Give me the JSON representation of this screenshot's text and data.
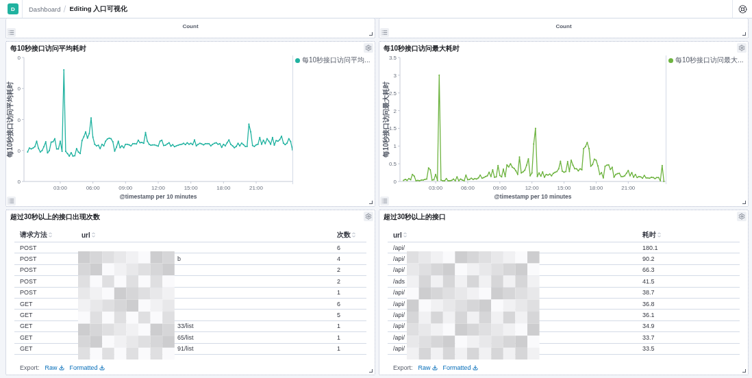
{
  "header": {
    "avatar": "D",
    "breadcrumbs": [
      {
        "label": "Dashboard",
        "current": false
      },
      {
        "label": "Editing 入口可视化",
        "current": true
      }
    ]
  },
  "top_panels": [
    {
      "axis_title": "Count"
    },
    {
      "axis_title": "Count"
    }
  ],
  "avg_panel": {
    "title": "每10秒接口访问平均耗时",
    "y_axis_title": "每10秒接口访问平均耗时",
    "y_tick_labels": [
      "0",
      "0",
      "0",
      "0",
      "0"
    ],
    "x_tick_labels": [
      "03:00",
      "06:00",
      "09:00",
      "12:00",
      "15:00",
      "18:00",
      "21:00"
    ],
    "x_axis_title": "@timestamp per 10 minutes",
    "legend": "每10秒接口访问平均..."
  },
  "max_panel": {
    "title": "每10秒接口访问最大耗时",
    "x_tick_labels": [
      "03:00",
      "06:00",
      "09:00",
      "12:00",
      "15:00",
      "18:00",
      "21:00"
    ],
    "chart_data": {
      "type": "line",
      "xlabel": "@timestamp per 10 minutes",
      "ylabel": "每10秒接口访问最大耗时",
      "ylim": [
        0,
        3.5
      ],
      "yticks": [
        0,
        {
          "value": 0.5,
          "label": "0.5"
        },
        {
          "value": 1,
          "label": "1"
        },
        {
          "value": 1.5,
          "label": "1.5"
        },
        {
          "value": 2,
          "label": "2"
        },
        {
          "value": 2.5,
          "label": "2.5"
        },
        {
          "value": 3,
          "label": "3"
        },
        {
          "value": 3.5,
          "label": "3.5"
        }
      ],
      "series": [
        {
          "name": "每10秒接口访问最大...",
          "color": "#6db33f",
          "values": [
            0.03,
            0.06,
            0.03,
            0.08,
            0.05,
            0.2,
            0.15,
            0.02,
            0.03,
            0.02,
            0.04,
            0.04,
            0.06,
            0.07,
            0.38,
            0.33,
            0.04,
            0.05,
            0.2,
            0.03,
            3.0,
            0.04,
            0.02,
            0.02,
            0.08,
            0.02,
            0.02,
            0.03,
            0.07,
            0.02,
            0.13,
            0.02,
            0.07,
            0.04,
            0.02,
            0.18,
            0.05,
            0.06,
            0.09,
            0.06,
            0.08,
            0.07,
            0.1,
            0.18,
            0.09,
            0.11,
            0.14,
            0.16,
            0.26,
            0.14,
            0.33,
            0.12,
            0.13,
            0.45,
            0.17,
            0.13,
            0.35,
            0.14,
            0.47,
            0.41,
            0.5,
            0.4,
            0.37,
            0.3,
            0.2,
            0.69,
            0.24,
            0.27,
            0.32,
            0.46,
            0.64,
            0.16,
            0.24,
            1.06,
            1.5,
            0.14,
            0.24,
            0.15,
            0.27,
            0.12,
            0.2,
            0.18,
            0.21,
            0.16,
            0.23,
            0.26,
            0.28,
            0.36,
            0.57,
            0.29,
            0.26,
            0.28,
            0.56,
            0.28,
            0.6,
            0.46,
            0.36,
            0.36,
            0.3,
            0.36,
            0.33,
            0.93,
            0.98,
            1.1,
            0.93,
            0.43,
            0.48,
            0.63,
            0.6,
            0.44,
            0.2,
            0.25,
            0.1,
            0.43,
            0.46,
            0.47,
            0.34,
            0.4,
            0.12,
            0.2,
            0.22,
            0.23,
            0.14,
            0.14,
            0.16,
            0.23,
            0.31,
            0.16,
            0.25,
            0.12,
            0.2,
            0.11,
            0.14,
            0.13,
            0.09,
            0.17,
            0.1,
            0.1,
            0.09,
            0.12,
            0.11,
            0.08,
            0.11,
            0.11,
            0.02,
            0.45,
            0.0
          ]
        }
      ]
    }
  },
  "tables": [
    {
      "kind": "count",
      "title": "超过30秒以上的接口出现次数",
      "columns": [
        "请求方法",
        "url",
        "次数"
      ],
      "rows": [
        {
          "method": "POST",
          "count": "6"
        },
        {
          "method": "POST",
          "url": "b",
          "count": "4"
        },
        {
          "method": "POST",
          "count": "2"
        },
        {
          "method": "POST",
          "count": "2"
        },
        {
          "method": "POST",
          "count": "1"
        },
        {
          "method": "GET",
          "count": "6"
        },
        {
          "method": "GET",
          "count": "5"
        },
        {
          "method": "GET",
          "url": "33/list",
          "count": "1"
        },
        {
          "method": "GET",
          "url": "65/list",
          "count": "1"
        },
        {
          "method": "GET",
          "url": "91/list",
          "count": "1"
        }
      ],
      "export_label": "Export:",
      "export_links": [
        "Raw",
        "Formatted"
      ]
    },
    {
      "kind": "duration",
      "title": "超过30秒以上的接口",
      "columns": [
        "url",
        "耗时"
      ],
      "rows": [
        {
          "url": "/api/",
          "value": "180.1"
        },
        {
          "url": "/api/",
          "value": "90.2"
        },
        {
          "url": "/api/",
          "value": "66.3"
        },
        {
          "url": "/ads",
          "value": "41.5"
        },
        {
          "url": "/api/",
          "value": "38.7"
        },
        {
          "url": "/api/",
          "value": "36.8"
        },
        {
          "url": "/api/",
          "value": "36.1"
        },
        {
          "url": "/api/",
          "value": "34.9"
        },
        {
          "url": "/api/",
          "value": "33.7"
        },
        {
          "url": "/api/",
          "value": "33.5"
        }
      ],
      "export_label": "Export:",
      "export_links": [
        "Raw",
        "Formatted"
      ]
    }
  ]
}
